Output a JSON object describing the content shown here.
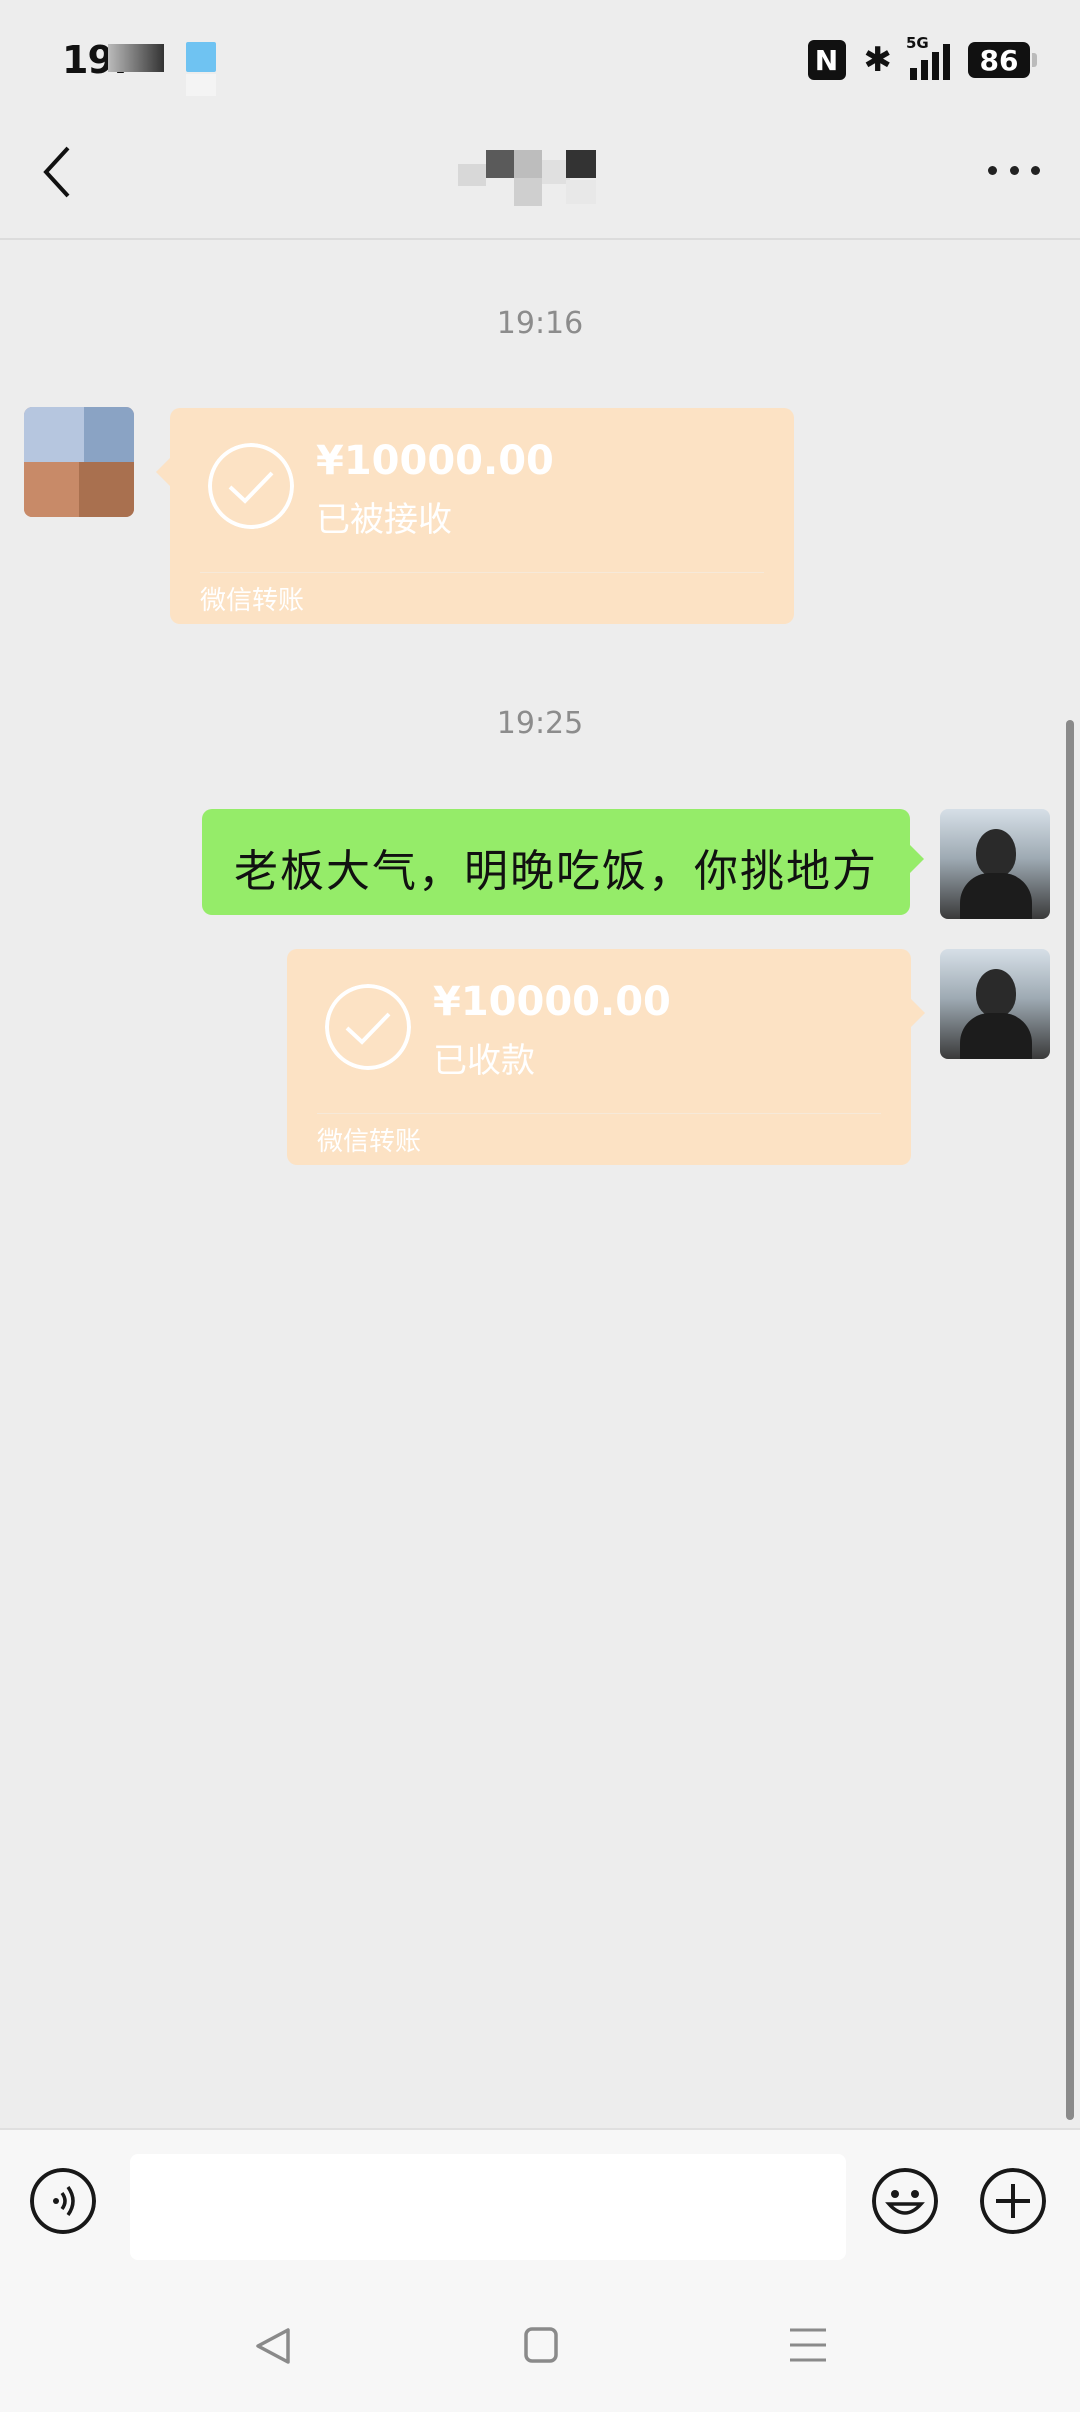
{
  "status_bar": {
    "time": "19:",
    "battery": "86",
    "network": "5G"
  },
  "messages": [
    {
      "type": "timestamp",
      "text": "19:16"
    },
    {
      "type": "transfer",
      "side": "left",
      "amount": "¥10000.00",
      "status": "已被接收",
      "label": "微信转账"
    },
    {
      "type": "timestamp",
      "text": "19:25"
    },
    {
      "type": "text",
      "side": "right",
      "text": "老板大气，明晚吃饭，你挑地方"
    },
    {
      "type": "transfer",
      "side": "right",
      "amount": "¥10000.00",
      "status": "已收款",
      "label": "微信转账"
    }
  ],
  "input": {
    "placeholder": ""
  },
  "colors": {
    "background": "#ededed",
    "transfer_bubble": "#fce2c4",
    "text_bubble": "#95ec69"
  },
  "icons": {
    "nav": [
      "back-arrow-icon",
      "more-icon"
    ],
    "input_bar": [
      "voice-icon",
      "emoji-icon",
      "plus-icon"
    ],
    "system_nav": [
      "back-triangle-icon",
      "home-square-icon",
      "menu-lines-icon"
    ]
  }
}
